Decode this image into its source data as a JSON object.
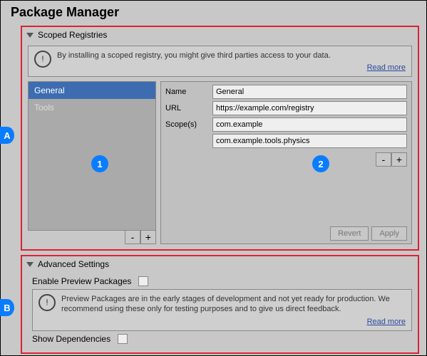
{
  "title": "Package Manager",
  "callouts": {
    "A": "A",
    "B": "B",
    "one": "1",
    "two": "2"
  },
  "scoped": {
    "header": "Scoped Registries",
    "info_text": "By installing a scoped registry, you might give third parties access to your data.",
    "read_more": "Read more",
    "list": {
      "items": [
        {
          "label": "General",
          "selected": true
        },
        {
          "label": "Tools",
          "selected": false
        }
      ],
      "remove_btn": "-",
      "add_btn": "+"
    },
    "form": {
      "name_label": "Name",
      "name_value": "General",
      "url_label": "URL",
      "url_value": "https://example.com/registry",
      "scopes_label": "Scope(s)",
      "scopes": [
        "com.example",
        "com.example.tools.physics"
      ],
      "remove_btn": "-",
      "add_btn": "+",
      "revert": "Revert",
      "apply": "Apply"
    }
  },
  "advanced": {
    "header": "Advanced Settings",
    "enable_preview_label": "Enable Preview Packages",
    "enable_preview_checked": false,
    "info_text": "Preview Packages are in the early stages of development and not yet ready for production. We recommend using these only for testing purposes and to give us direct feedback.",
    "read_more": "Read more",
    "show_deps_label": "Show Dependencies",
    "show_deps_checked": false
  }
}
